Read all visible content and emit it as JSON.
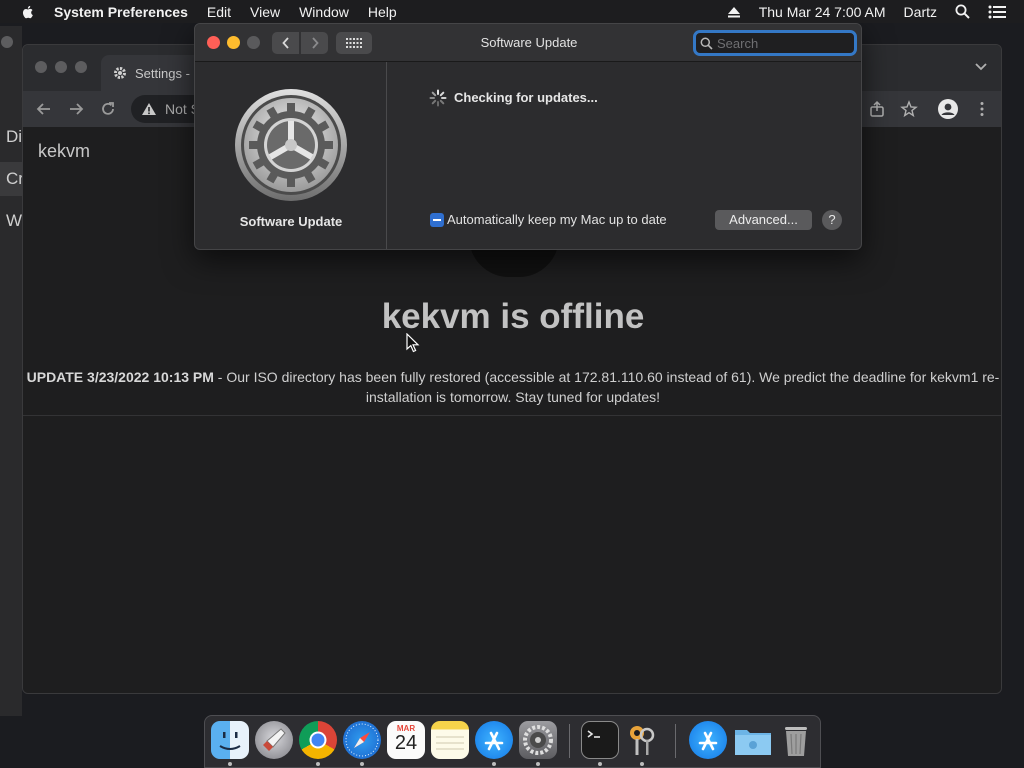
{
  "menubar": {
    "app_name": "System Preferences",
    "menus": [
      "Edit",
      "View",
      "Window",
      "Help"
    ],
    "clock": "Thu Mar 24  7:00 AM",
    "user": "Dartz"
  },
  "browser": {
    "tab_title": "Settings -",
    "url_text": "Not S",
    "brand": "kekvm",
    "offline_title": "kekvm is offline",
    "update_bold": "UPDATE 3/23/2022 10:13 PM",
    "update_text": " - Our ISO directory has been fully restored (accessible at 172.81.110.60 instead of 61). We predict the deadline for kekvm1 re-installation is tomorrow. Stay tuned for updates!"
  },
  "left_window": {
    "rows": [
      "Di",
      "Cr",
      "W"
    ]
  },
  "software_update": {
    "window_title": "Software Update",
    "search_placeholder": "Search",
    "sidebar_label": "Software Update",
    "status_text": "Checking for updates...",
    "auto_update_label": "Automatically keep my Mac up to date",
    "auto_update_checked": true,
    "advanced_label": "Advanced...",
    "help_label": "?"
  },
  "dock": {
    "items": [
      "finder-icon",
      "launchpad-icon",
      "chrome-icon",
      "safari-icon",
      "calendar-icon",
      "notes-icon",
      "app-store-icon",
      "system-preferences-icon",
      "terminal-icon",
      "keychain-access-icon",
      "app-store-icon",
      "downloads-folder-icon",
      "trash-icon"
    ],
    "calendar_month": "MAR",
    "calendar_day": "24"
  },
  "colors": {
    "accent": "#3478c6",
    "close": "#ff5f57",
    "minimize": "#febc2e",
    "zoom_disabled": "#5a5a5c"
  }
}
